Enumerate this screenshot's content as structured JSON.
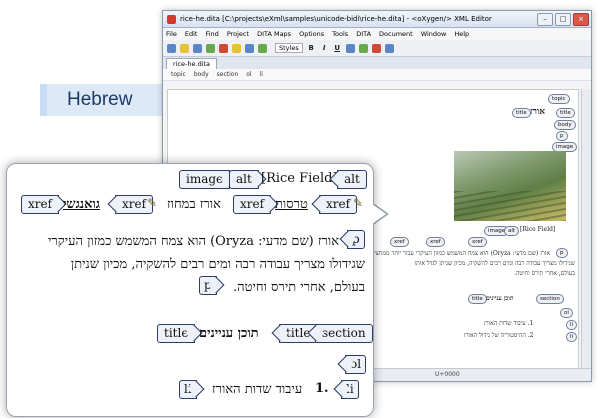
{
  "side_label": "Hebrew",
  "window": {
    "title": "rice-he.dita [C:\\projects\\eXml\\samples\\unicode-bidi\\rice-he.dita] - <oXygen/> XML Editor",
    "menu": [
      "File",
      "Edit",
      "Find",
      "Project",
      "DITA Maps",
      "Options",
      "Tools",
      "DITA",
      "Document",
      "Window",
      "Help"
    ],
    "styles_label": "Styles",
    "tab": "rice-he.dita",
    "breadcrumb": [
      "topic",
      "body",
      "section",
      "ol",
      "li"
    ],
    "status_text": "U+0000",
    "toolbar_letters": {
      "bold": "B",
      "italic": "I",
      "underline": "U"
    }
  },
  "small_editor": {
    "tags": [
      "topic",
      "title",
      "body",
      "p",
      "image",
      "alt",
      "xref",
      "section",
      "title",
      "ol",
      "li",
      "li"
    ],
    "title_text": "אורז",
    "alt_text": "[Rice Field]",
    "para_line1": "אורז (שם מדעי: Oryza) הוא צמח המשמש כמזון העיקרי עבור יותר ממחצית",
    "para_line2": "שגידולו מצריך עבודה רבה ומים רבים להשקיה, מכיון שניתן לגדל אותו",
    "para_line3": "בעולם, אחרי תירס וחיטה.",
    "section_title": "תוכן עניינים",
    "li1": "1. עיבוד שדות האורז",
    "li2": "2. ההיסטוריה של גידול האורז"
  },
  "magnifier": {
    "tags": {
      "image": "image",
      "alt": "alt",
      "alt_close": "alt",
      "xref": "xref",
      "p": "p",
      "title": "title",
      "section": "section",
      "ol": "ol",
      "li": "li"
    },
    "alt_text": "[Rice Field]",
    "xref_line": {
      "link1": "טרסות",
      "middle": "אורז במחוז",
      "link2": "גואנגשי"
    },
    "para": [
      "אורז (שם מדעי: Oryza) הוא צמח המשמש כמזון העיקרי",
      "שגידולו מצריך עבודה רבה ומים רבים להשקיה, מכיון שניתן",
      "בעולם, אחרי תירס וחיטה."
    ],
    "section_title": "תוכן עניינים",
    "li_number": "1.",
    "li_text": "עיבוד שדות האורז"
  }
}
